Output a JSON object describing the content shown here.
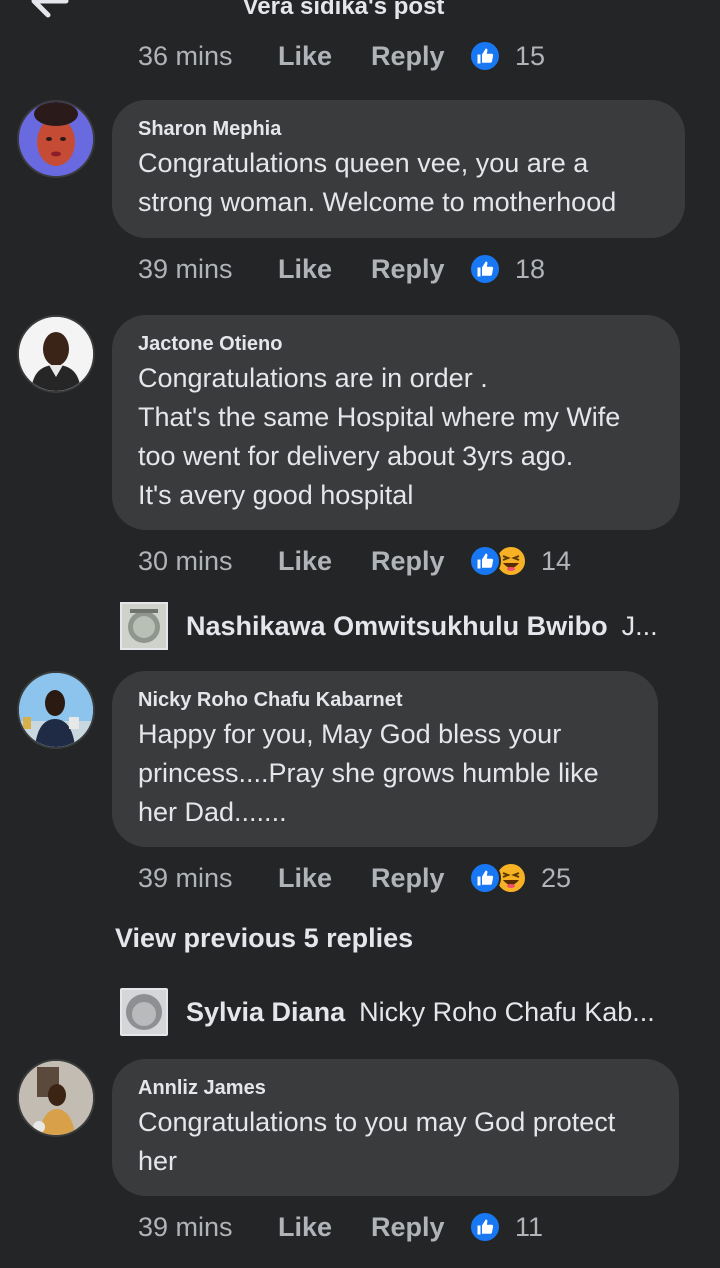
{
  "header": {
    "title": "Vera sidika's post"
  },
  "comments": [
    {
      "meta": {
        "time": "36 mins",
        "like": "Like",
        "reply": "Reply",
        "count": "15"
      }
    },
    {
      "author": "Sharon Mephia",
      "text": "Congratulations queen vee, you are a strong woman. Welcome to motherhood",
      "meta": {
        "time": "39 mins",
        "like": "Like",
        "reply": "Reply",
        "count": "18"
      }
    },
    {
      "author": "Jactone Otieno",
      "text": "Congratulations are in order .\nThat's the same Hospital where my Wife too went for delivery about 3yrs ago.\nIt's avery good hospital",
      "meta": {
        "time": "30 mins",
        "like": "Like",
        "reply": "Reply",
        "count": "14"
      },
      "reply_preview": {
        "name": "Nashikawa Omwitsukhulu Bwibo",
        "text": "J..."
      }
    },
    {
      "author": "Nicky Roho Chafu Kabarnet",
      "text": "Happy for you, May God bless your princess....Pray she grows humble like her Dad.......",
      "meta": {
        "time": "39 mins",
        "like": "Like",
        "reply": "Reply",
        "count": "25"
      },
      "view_previous": "View previous 5 replies",
      "reply_preview": {
        "name": "Sylvia Diana",
        "text": "Nicky Roho Chafu Kab..."
      }
    },
    {
      "author": "Annliz James",
      "text": "Congratulations to you may God protect her",
      "meta": {
        "time": "39 mins",
        "like": "Like",
        "reply": "Reply",
        "count": "11"
      }
    }
  ],
  "colors": {
    "background": "#242526",
    "bubble": "#3a3b3c",
    "text_primary": "#e4e6eb",
    "text_secondary": "#b0b3b8",
    "like_blue": "#1877f2",
    "haha_yellow": "#f7b125"
  },
  "icons": {
    "back": "arrow-left-icon",
    "like_reaction": "thumbs-up-icon",
    "haha_reaction": "laughing-face-icon"
  }
}
